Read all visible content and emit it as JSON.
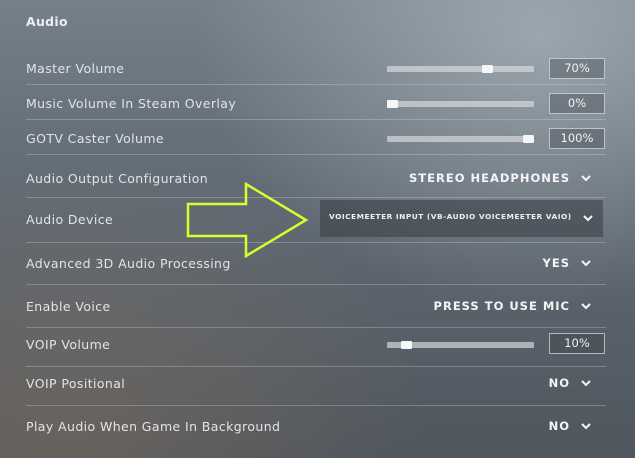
{
  "section": {
    "title": "Audio"
  },
  "settings": {
    "master_volume": {
      "label": "Master Volume",
      "value": "70%",
      "level": 0.7
    },
    "music_volume": {
      "label": "Music Volume In Steam Overlay",
      "value": "0%",
      "level": 0.0
    },
    "gotv_volume": {
      "label": "GOTV Caster Volume",
      "value": "100%",
      "level": 1.0
    },
    "output_config": {
      "label": "Audio Output Configuration",
      "value": "STEREO HEADPHONES"
    },
    "audio_device": {
      "label": "Audio Device",
      "value": "VOICEMEETER INPUT (VB-AUDIO VOICEMEETER VAIO)"
    },
    "advanced_3d": {
      "label": "Advanced 3D Audio Processing",
      "value": "YES"
    },
    "enable_voice": {
      "label": "Enable Voice",
      "value": "PRESS TO USE MIC"
    },
    "voip_volume": {
      "label": "VOIP Volume",
      "value": "10%",
      "level": 0.1
    },
    "voip_positional": {
      "label": "VOIP Positional",
      "value": "NO"
    },
    "play_in_background": {
      "label": "Play Audio When Game In Background",
      "value": "NO"
    }
  },
  "icons": {
    "dropdown": "chevron-down-icon",
    "annotation": "arrow-right-icon"
  },
  "colors": {
    "annotation_arrow": "#d9ff2a",
    "slider_track": "#dcdee0",
    "slider_thumb": "#f5f6f7"
  }
}
